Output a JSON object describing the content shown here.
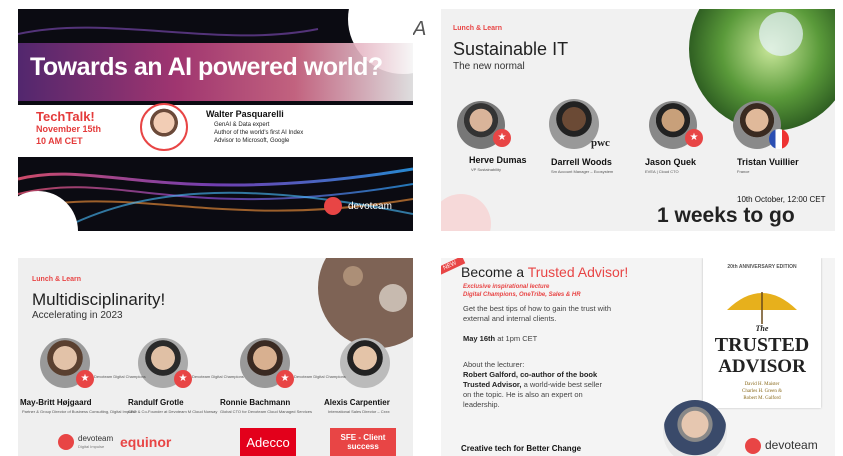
{
  "cursor_label": "A",
  "colors": {
    "accent_red": "#e84545",
    "dark": "#0b0b12"
  },
  "cards": [
    {
      "title": "Towards an AI powered world?",
      "event": "TechTalk!",
      "date": "November 15th",
      "time": "10 AM CET",
      "speaker": "Walter Pasquarelli",
      "bullets": [
        "GenAI & Data expert",
        "Author of the world's first AI Index",
        "Advisor to Microsoft, Google"
      ],
      "brand": "devoteam"
    },
    {
      "kicker": "Lunch & Learn",
      "title": "Sustainable IT",
      "subtitle": "The new normal",
      "speakers": [
        {
          "name": "Herve Dumas",
          "role": "VP Sustainability",
          "badge": "Devoteam Digital Champions"
        },
        {
          "name": "Darrell Woods",
          "role": "Sm Account Manager – Ecosystem",
          "badge": "pwc"
        },
        {
          "name": "Jason Quek",
          "role": "EVEA | Cloud CTO",
          "badge": "Devoteam Digital Champions"
        },
        {
          "name": "Tristan Vuillier",
          "role": "France",
          "badge": ""
        }
      ],
      "date": "10th October, 12:00 CET",
      "countdown": "1 weeks to go"
    },
    {
      "kicker": "Lunch & Learn",
      "title": "Multidisciplinarity!",
      "subtitle": "Accelerating in 2023",
      "speakers": [
        {
          "name": "May-Britt Højgaard",
          "role": "Partner & Group Director of Business Consulting, Digital Impulse"
        },
        {
          "name": "Randulf Grotle",
          "role": "CEO & Co-Founder at Devoteam M Cloud Norway"
        },
        {
          "name": "Ronnie Bachmann",
          "role": "Global CTO for Devoteam Cloud Managed Services"
        },
        {
          "name": "Alexis Carpentier",
          "role": "International Sales Director – Cxxx"
        }
      ],
      "badge": "Devoteam Digital Champions",
      "logos": [
        "devoteam",
        "equinor",
        "Adecco",
        "SFE - Client success"
      ],
      "logo_sub": "Digital Impulse"
    },
    {
      "tag": "NEW",
      "title_prefix": "Become a",
      "title_highlight": "Trusted Advisor!",
      "lecture_line1": "Exclusive inspirational lecture",
      "lecture_line2": "Digital Champions, OneTribe, Sales & HR",
      "intro_line1": "Get the best tips of how to gain the trust  with",
      "intro_line2": "external and internal clients.",
      "date_bold": "May 16th",
      "date_rest": "at 1pm CET",
      "about": "About the lecturer:",
      "bio": [
        {
          "bold": "Robert Galford,  co-author of the book",
          "rest": ""
        },
        {
          "bold": "Trusted Advisor,",
          "rest": " a world-wide best seller"
        },
        {
          "bold": "",
          "rest": "on the topic. He is also an expert on"
        },
        {
          "bold": "",
          "rest": "leadership."
        }
      ],
      "footer": "Creative tech for Better Change",
      "brand": "devoteam",
      "book": {
        "edition": "20th ANNIVERSARY EDITION",
        "the": "The",
        "line1": "TRUSTED",
        "line2": "ADVISOR",
        "authors": [
          "David H. Maister",
          "Charles H. Green &",
          "Robert M. Galford"
        ]
      }
    }
  ]
}
